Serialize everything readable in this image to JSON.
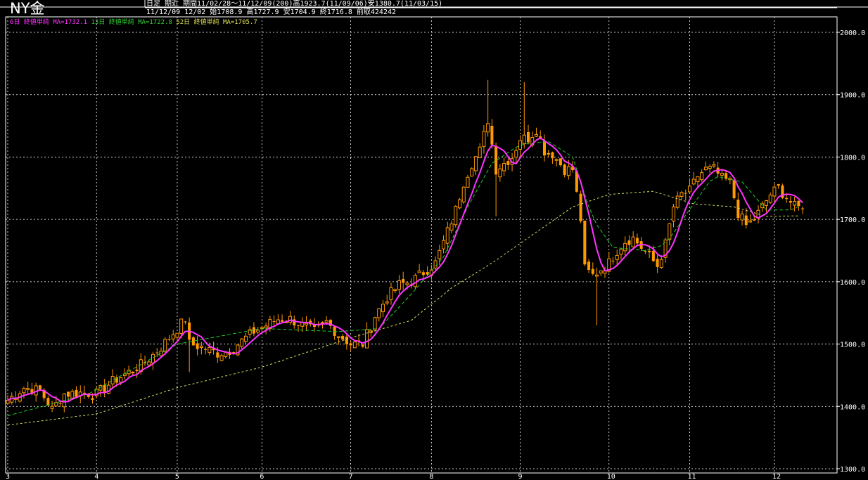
{
  "header": {
    "title": "NY金",
    "line1": "日足 期近 期間11/02/28～11/12/09(200)高1923.7(11/09/06)安1380.7(11/03/15)",
    "line2": "11/12/09 12/02 始1708.9 高1727.9 安1704.9 終1716.8 前取424242"
  },
  "legend": [
    {
      "text": "6日 終値単純 MA=1732.1",
      "color": "#ff33ff"
    },
    {
      "text": "13日 終値単純 MA=1722.8",
      "color": "#33cc33"
    },
    {
      "text": "52日 終値単純 MA=1705.7",
      "color": "#dddd55"
    }
  ],
  "colors": {
    "background": "#000000",
    "grid": "#ffffff",
    "candle": "#ff9900",
    "ma6": "#ff33ff",
    "ma13": "#22cc22",
    "ma52": "#dddd66"
  },
  "chart_data": {
    "type": "candlestick",
    "ylim": [
      1300,
      2000
    ],
    "y_ticks": [
      "1300.0",
      "1400.0",
      "1500.0",
      "1600.0",
      "1700.0",
      "1800.0",
      "1900.0",
      "2000.0"
    ],
    "x_ticks": [
      "3",
      "4",
      "5",
      "6",
      "7",
      "8",
      "9",
      "10",
      "11",
      "12"
    ],
    "x_tick_index": [
      0,
      22,
      42,
      63,
      85,
      105,
      127,
      149,
      169,
      190
    ],
    "close_points": [
      [
        0,
        1410
      ],
      [
        4,
        1430
      ],
      [
        8,
        1425
      ],
      [
        11,
        1395
      ],
      [
        14,
        1420
      ],
      [
        18,
        1422
      ],
      [
        22,
        1420
      ],
      [
        26,
        1440
      ],
      [
        30,
        1455
      ],
      [
        34,
        1470
      ],
      [
        38,
        1495
      ],
      [
        42,
        1525
      ],
      [
        44,
        1540
      ],
      [
        45,
        1500
      ],
      [
        48,
        1495
      ],
      [
        52,
        1485
      ],
      [
        55,
        1490
      ],
      [
        58,
        1505
      ],
      [
        61,
        1520
      ],
      [
        64,
        1530
      ],
      [
        67,
        1540
      ],
      [
        70,
        1540
      ],
      [
        73,
        1530
      ],
      [
        76,
        1520
      ],
      [
        79,
        1535
      ],
      [
        82,
        1515
      ],
      [
        85,
        1500
      ],
      [
        88,
        1500
      ],
      [
        91,
        1545
      ],
      [
        94,
        1575
      ],
      [
        97,
        1595
      ],
      [
        100,
        1600
      ],
      [
        103,
        1615
      ],
      [
        106,
        1630
      ],
      [
        109,
        1680
      ],
      [
        111,
        1715
      ],
      [
        113,
        1760
      ],
      [
        115,
        1790
      ],
      [
        117,
        1810
      ],
      [
        119,
        1860
      ],
      [
        121,
        1780
      ],
      [
        123,
        1790
      ],
      [
        125,
        1800
      ],
      [
        127,
        1830
      ],
      [
        129,
        1830
      ],
      [
        131,
        1845
      ],
      [
        133,
        1810
      ],
      [
        135,
        1805
      ],
      [
        138,
        1780
      ],
      [
        140,
        1780
      ],
      [
        142,
        1700
      ],
      [
        143,
        1620
      ],
      [
        145,
        1610
      ],
      [
        147,
        1620
      ],
      [
        149,
        1630
      ],
      [
        151,
        1650
      ],
      [
        153,
        1665
      ],
      [
        155,
        1670
      ],
      [
        157,
        1655
      ],
      [
        159,
        1640
      ],
      [
        161,
        1625
      ],
      [
        163,
        1660
      ],
      [
        165,
        1720
      ],
      [
        167,
        1740
      ],
      [
        169,
        1745
      ],
      [
        171,
        1770
      ],
      [
        173,
        1780
      ],
      [
        175,
        1780
      ],
      [
        177,
        1765
      ],
      [
        179,
        1760
      ],
      [
        181,
        1710
      ],
      [
        183,
        1690
      ],
      [
        185,
        1700
      ],
      [
        187,
        1720
      ],
      [
        189,
        1740
      ],
      [
        191,
        1750
      ],
      [
        193,
        1735
      ],
      [
        195,
        1720
      ],
      [
        197,
        1716.8
      ]
    ],
    "spikes": [
      [
        119,
        1923.7
      ],
      [
        128,
        1920
      ],
      [
        146,
        1530
      ],
      [
        121,
        1705
      ],
      [
        45,
        1455
      ]
    ],
    "ma13_points": [
      [
        0,
        1385
      ],
      [
        20,
        1420
      ],
      [
        42,
        1500
      ],
      [
        63,
        1525
      ],
      [
        82,
        1520
      ],
      [
        92,
        1525
      ],
      [
        100,
        1580
      ],
      [
        108,
        1640
      ],
      [
        114,
        1720
      ],
      [
        120,
        1790
      ],
      [
        127,
        1820
      ],
      [
        134,
        1825
      ],
      [
        140,
        1800
      ],
      [
        145,
        1700
      ],
      [
        150,
        1655
      ],
      [
        158,
        1650
      ],
      [
        163,
        1660
      ],
      [
        170,
        1725
      ],
      [
        175,
        1770
      ],
      [
        182,
        1760
      ],
      [
        188,
        1715
      ],
      [
        194,
        1715
      ],
      [
        197,
        1722.8
      ]
    ],
    "ma52_points": [
      [
        0,
        1370
      ],
      [
        22,
        1388
      ],
      [
        42,
        1430
      ],
      [
        63,
        1463
      ],
      [
        85,
        1510
      ],
      [
        100,
        1538
      ],
      [
        110,
        1590
      ],
      [
        120,
        1630
      ],
      [
        130,
        1675
      ],
      [
        140,
        1720
      ],
      [
        149,
        1740
      ],
      [
        160,
        1745
      ],
      [
        170,
        1725
      ],
      [
        180,
        1720
      ],
      [
        188,
        1705
      ],
      [
        197,
        1705.7
      ]
    ]
  }
}
